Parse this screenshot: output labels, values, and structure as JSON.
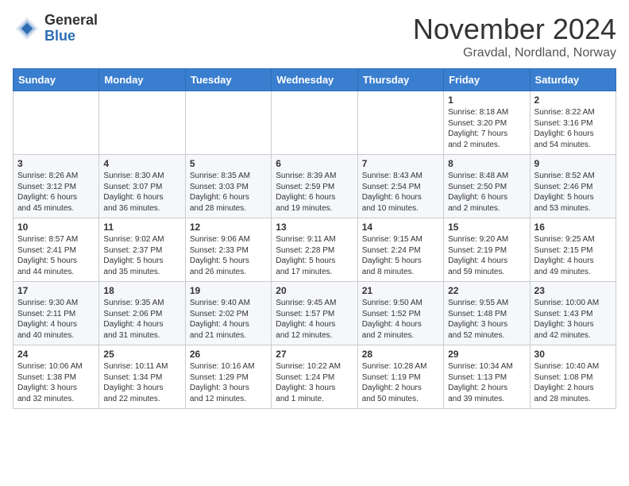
{
  "header": {
    "logo_general": "General",
    "logo_blue": "Blue",
    "month_title": "November 2024",
    "location": "Gravdal, Nordland, Norway"
  },
  "days_of_week": [
    "Sunday",
    "Monday",
    "Tuesday",
    "Wednesday",
    "Thursday",
    "Friday",
    "Saturday"
  ],
  "weeks": [
    [
      {
        "day": "",
        "info": ""
      },
      {
        "day": "",
        "info": ""
      },
      {
        "day": "",
        "info": ""
      },
      {
        "day": "",
        "info": ""
      },
      {
        "day": "",
        "info": ""
      },
      {
        "day": "1",
        "info": "Sunrise: 8:18 AM\nSunset: 3:20 PM\nDaylight: 7 hours\nand 2 minutes."
      },
      {
        "day": "2",
        "info": "Sunrise: 8:22 AM\nSunset: 3:16 PM\nDaylight: 6 hours\nand 54 minutes."
      }
    ],
    [
      {
        "day": "3",
        "info": "Sunrise: 8:26 AM\nSunset: 3:12 PM\nDaylight: 6 hours\nand 45 minutes."
      },
      {
        "day": "4",
        "info": "Sunrise: 8:30 AM\nSunset: 3:07 PM\nDaylight: 6 hours\nand 36 minutes."
      },
      {
        "day": "5",
        "info": "Sunrise: 8:35 AM\nSunset: 3:03 PM\nDaylight: 6 hours\nand 28 minutes."
      },
      {
        "day": "6",
        "info": "Sunrise: 8:39 AM\nSunset: 2:59 PM\nDaylight: 6 hours\nand 19 minutes."
      },
      {
        "day": "7",
        "info": "Sunrise: 8:43 AM\nSunset: 2:54 PM\nDaylight: 6 hours\nand 10 minutes."
      },
      {
        "day": "8",
        "info": "Sunrise: 8:48 AM\nSunset: 2:50 PM\nDaylight: 6 hours\nand 2 minutes."
      },
      {
        "day": "9",
        "info": "Sunrise: 8:52 AM\nSunset: 2:46 PM\nDaylight: 5 hours\nand 53 minutes."
      }
    ],
    [
      {
        "day": "10",
        "info": "Sunrise: 8:57 AM\nSunset: 2:41 PM\nDaylight: 5 hours\nand 44 minutes."
      },
      {
        "day": "11",
        "info": "Sunrise: 9:02 AM\nSunset: 2:37 PM\nDaylight: 5 hours\nand 35 minutes."
      },
      {
        "day": "12",
        "info": "Sunrise: 9:06 AM\nSunset: 2:33 PM\nDaylight: 5 hours\nand 26 minutes."
      },
      {
        "day": "13",
        "info": "Sunrise: 9:11 AM\nSunset: 2:28 PM\nDaylight: 5 hours\nand 17 minutes."
      },
      {
        "day": "14",
        "info": "Sunrise: 9:15 AM\nSunset: 2:24 PM\nDaylight: 5 hours\nand 8 minutes."
      },
      {
        "day": "15",
        "info": "Sunrise: 9:20 AM\nSunset: 2:19 PM\nDaylight: 4 hours\nand 59 minutes."
      },
      {
        "day": "16",
        "info": "Sunrise: 9:25 AM\nSunset: 2:15 PM\nDaylight: 4 hours\nand 49 minutes."
      }
    ],
    [
      {
        "day": "17",
        "info": "Sunrise: 9:30 AM\nSunset: 2:11 PM\nDaylight: 4 hours\nand 40 minutes."
      },
      {
        "day": "18",
        "info": "Sunrise: 9:35 AM\nSunset: 2:06 PM\nDaylight: 4 hours\nand 31 minutes."
      },
      {
        "day": "19",
        "info": "Sunrise: 9:40 AM\nSunset: 2:02 PM\nDaylight: 4 hours\nand 21 minutes."
      },
      {
        "day": "20",
        "info": "Sunrise: 9:45 AM\nSunset: 1:57 PM\nDaylight: 4 hours\nand 12 minutes."
      },
      {
        "day": "21",
        "info": "Sunrise: 9:50 AM\nSunset: 1:52 PM\nDaylight: 4 hours\nand 2 minutes."
      },
      {
        "day": "22",
        "info": "Sunrise: 9:55 AM\nSunset: 1:48 PM\nDaylight: 3 hours\nand 52 minutes."
      },
      {
        "day": "23",
        "info": "Sunrise: 10:00 AM\nSunset: 1:43 PM\nDaylight: 3 hours\nand 42 minutes."
      }
    ],
    [
      {
        "day": "24",
        "info": "Sunrise: 10:06 AM\nSunset: 1:38 PM\nDaylight: 3 hours\nand 32 minutes."
      },
      {
        "day": "25",
        "info": "Sunrise: 10:11 AM\nSunset: 1:34 PM\nDaylight: 3 hours\nand 22 minutes."
      },
      {
        "day": "26",
        "info": "Sunrise: 10:16 AM\nSunset: 1:29 PM\nDaylight: 3 hours\nand 12 minutes."
      },
      {
        "day": "27",
        "info": "Sunrise: 10:22 AM\nSunset: 1:24 PM\nDaylight: 3 hours\nand 1 minute."
      },
      {
        "day": "28",
        "info": "Sunrise: 10:28 AM\nSunset: 1:19 PM\nDaylight: 2 hours\nand 50 minutes."
      },
      {
        "day": "29",
        "info": "Sunrise: 10:34 AM\nSunset: 1:13 PM\nDaylight: 2 hours\nand 39 minutes."
      },
      {
        "day": "30",
        "info": "Sunrise: 10:40 AM\nSunset: 1:08 PM\nDaylight: 2 hours\nand 28 minutes."
      }
    ]
  ]
}
